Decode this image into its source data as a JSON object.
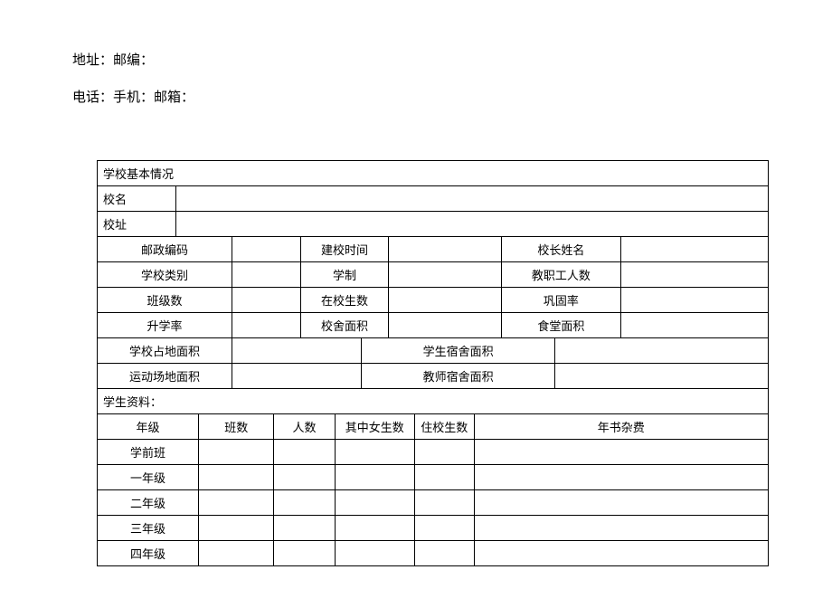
{
  "header": {
    "line1": "地址：邮编：",
    "line2": "电话：手机：邮箱："
  },
  "section_title": "学校基本情况",
  "labels": {
    "school_name": "校名",
    "school_addr": "校址",
    "postal": "邮政编码",
    "founded": "建校时间",
    "principal": "校长姓名",
    "category": "学校类别",
    "edu_system": "学制",
    "staff_count": "教职工人数",
    "class_count": "班级数",
    "student_count": "在校生数",
    "consolid_rate": "巩固率",
    "promo_rate": "升学率",
    "bldg_area": "校舍面积",
    "canteen_area": "食堂面积",
    "land_area": "学校占地面积",
    "dorm_area": "学生宿舍面积",
    "field_area": "运动场地面积",
    "teacher_dorm": "教师宿舍面积"
  },
  "student_section": "学生资料：",
  "student_headers": {
    "grade": "年级",
    "classes": "班数",
    "people": "人数",
    "girls": "其中女生数",
    "boarders": "住校生数",
    "fee": "年书杂费"
  },
  "grades": {
    "g0": "学前班",
    "g1": "一年级",
    "g2": "二年级",
    "g3": "三年级",
    "g4": "四年级"
  }
}
